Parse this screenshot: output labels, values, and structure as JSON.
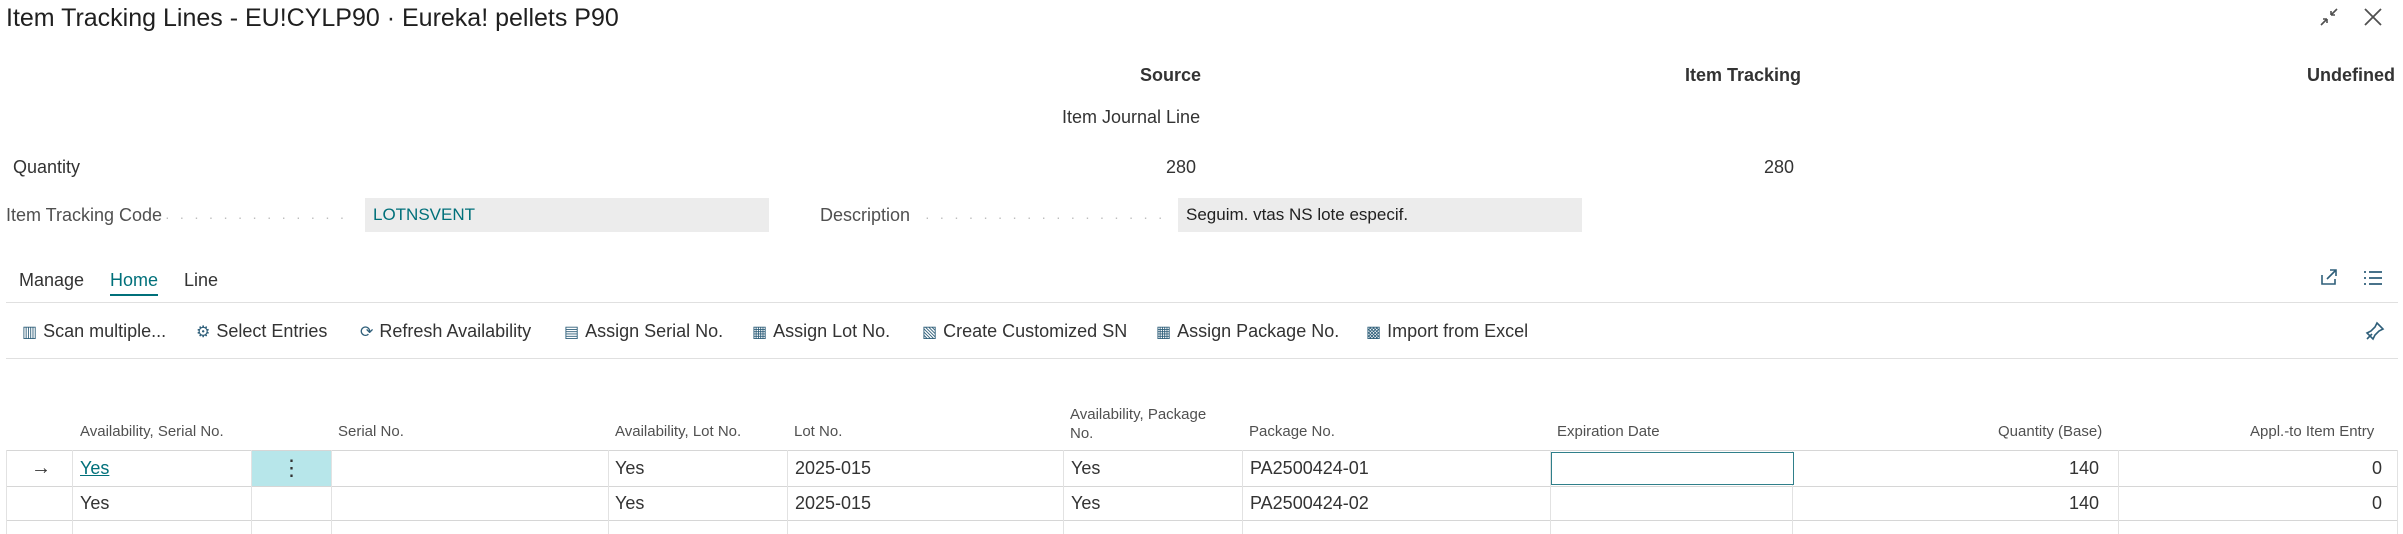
{
  "window": {
    "title": "Item Tracking Lines - EU!CYLP90 · Eureka! pellets P90",
    "collapse_icon": "collapse-icon",
    "close_icon": "close-icon"
  },
  "summary": {
    "headers": {
      "source": "Source",
      "item_tracking": "Item Tracking",
      "undefined": "Undefined"
    },
    "source_type": "Item Journal Line",
    "quantity_label": "Quantity",
    "quantity_source": "280",
    "quantity_item_tracking": "280"
  },
  "fields": {
    "item_tracking_code": {
      "label": "Item Tracking Code",
      "value": "LOTNSVENT"
    },
    "description": {
      "label": "Description",
      "value": "Seguim. vtas NS lote especif."
    }
  },
  "tabs": [
    {
      "label": "Manage"
    },
    {
      "label": "Home"
    },
    {
      "label": "Line"
    }
  ],
  "actions": [
    {
      "label": "Scan multiple...",
      "icon": "barcode-icon"
    },
    {
      "label": "Select Entries",
      "icon": "select-entries-icon"
    },
    {
      "label": "Refresh Availability",
      "icon": "refresh-icon"
    },
    {
      "label": "Assign Serial No.",
      "icon": "serial-no-icon"
    },
    {
      "label": "Assign Lot No.",
      "icon": "lot-no-icon"
    },
    {
      "label": "Create Customized SN",
      "icon": "customized-sn-icon"
    },
    {
      "label": "Assign Package No.",
      "icon": "package-no-icon"
    },
    {
      "label": "Import from Excel",
      "icon": "excel-import-icon"
    }
  ],
  "table": {
    "columns": {
      "availability_serial": "Availability, Serial No.",
      "serial_no": "Serial No.",
      "availability_lot": "Availability, Lot No.",
      "lot_no": "Lot No.",
      "availability_package_1": "Availability, Package",
      "availability_package_2": "No.",
      "package_no": "Package No.",
      "expiration_date": "Expiration Date",
      "quantity_base": "Quantity (Base)",
      "appl_to_item_entry": "Appl.-to Item Entry"
    },
    "rows": [
      {
        "availability_serial": "Yes",
        "serial_no": "",
        "availability_lot": "Yes",
        "lot_no": "2025-015",
        "availability_package": "Yes",
        "package_no": "PA2500424-01",
        "expiration_date": "",
        "quantity_base": "140",
        "appl_to_item_entry": "0"
      },
      {
        "availability_serial": "Yes",
        "serial_no": "",
        "availability_lot": "Yes",
        "lot_no": "2025-015",
        "availability_package": "Yes",
        "package_no": "PA2500424-02",
        "expiration_date": "",
        "quantity_base": "140",
        "appl_to_item_entry": "0"
      }
    ]
  },
  "colors": {
    "accent": "#00707a",
    "field_bg": "#ececec",
    "selected_button_bg": "#b7e6ea"
  }
}
